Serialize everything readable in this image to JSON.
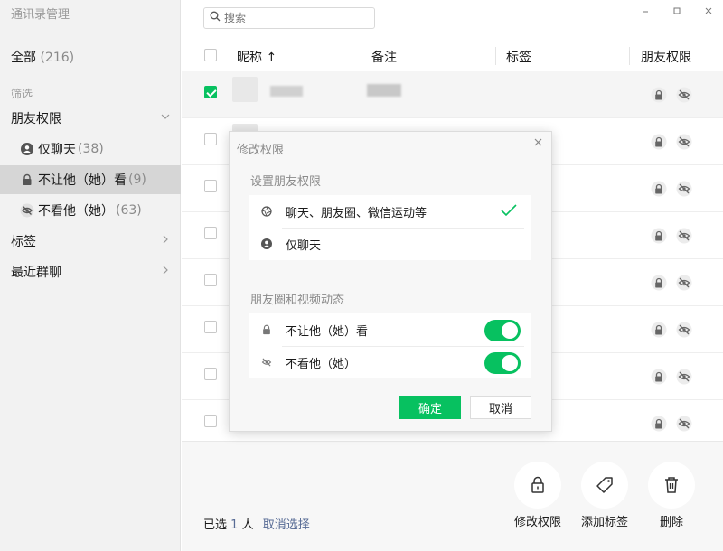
{
  "app": {
    "title": "通讯录管理"
  },
  "sidebar": {
    "all_label": "全部",
    "all_count": "(216)",
    "filter_label": "筛选",
    "sections": {
      "friend_perm": "朋友权限",
      "tags": "标签",
      "recent_groups": "最近群聊"
    },
    "items": [
      {
        "label": "仅聊天",
        "count": "(38)"
      },
      {
        "label": "不让他（她）看",
        "count": "(9)"
      },
      {
        "label": "不看他（她）",
        "count": "(63)"
      }
    ]
  },
  "search": {
    "placeholder": "搜索"
  },
  "table": {
    "headers": {
      "nickname": "昵称",
      "sort_arrow": "↑",
      "remark": "备注",
      "tag": "标签",
      "permission": "朋友权限"
    }
  },
  "dialog": {
    "title": "修改权限",
    "section1": "设置朋友权限",
    "opt_all": "聊天、朋友圈、微信运动等",
    "opt_chat_only": "仅聊天",
    "section2": "朋友圈和视频动态",
    "toggle_block": "不让他（她）看",
    "toggle_hide": "不看他（她）",
    "ok": "确定",
    "cancel": "取消"
  },
  "bottom": {
    "selected_prefix": "已选",
    "selected_count": "1",
    "selected_unit": "人",
    "cancel_select": "取消选择",
    "actions": {
      "modify_perm": "修改权限",
      "add_tag": "添加标签",
      "delete": "删除"
    }
  },
  "colors": {
    "accent_green": "#07c160",
    "link_blue": "#576b95"
  }
}
